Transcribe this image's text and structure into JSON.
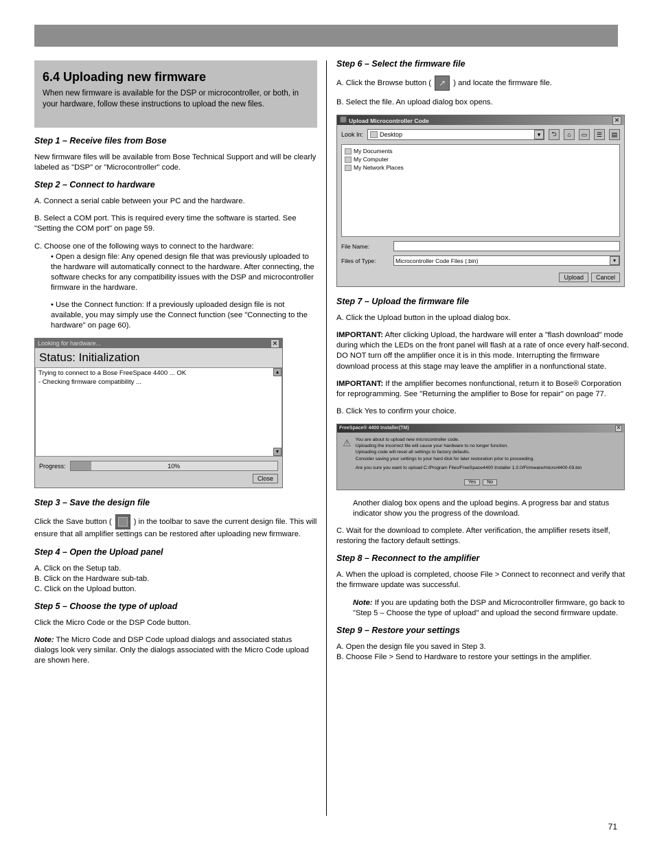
{
  "page_number": "71",
  "intro": {
    "title": "6.4 Uploading new firmware",
    "text": "When new firmware is available for the DSP or microcontroller, or both, in your hardware, follow these instructions to upload the new files."
  },
  "left": {
    "step1_heading": "Step 1 – Receive files from Bose",
    "step1_text": "New firmware files will be available from Bose Technical Support and will be clearly labeled as \"DSP\" or \"Microcontroller\" code.",
    "step2_heading": "Step 2 – Connect to hardware",
    "step2_a": "A. Connect a serial cable between your PC and the hardware.",
    "step2_b": "B. Select a COM port. This is required every time the software is started. See \"Setting the COM port\" on page 59.",
    "step2_c": "C. Choose one of the following ways to connect to the hardware:",
    "step2_c1": "• Open a design file: Any opened design file that was previously uploaded to the hardware will automatically connect to the hardware. After connecting, the software checks for any compatibility issues with the DSP and microcontroller firmware in the hardware.",
    "step2_c2": "• Use the Connect function: If a previously uploaded design file is not available, you may simply use the Connect function (see \"Connecting to the hardware\" on page 60).",
    "hw_dialog": {
      "title": "Looking for hardware...",
      "status_prefix": "Status:",
      "status_value": "Initialization",
      "log_line1": "Trying to connect to a Bose FreeSpace 4400 ... OK",
      "log_line2": "- Checking firmware compatibility ...",
      "progress_label": "Progress:",
      "progress_percent": 10,
      "progress_text": "10%",
      "close": "Close"
    },
    "step3_heading": "Step 3 – Save the design file",
    "step3_text_a": "Click the Save button (",
    "step3_text_b": ") in the toolbar to save the current design file. This will ensure that all amplifier settings can be restored after uploading new firmware.",
    "step4_heading": "Step 4 – Open the Upload panel",
    "step4_a": "A. Click on the Setup tab.",
    "step4_b": "B. Click on the Hardware sub-tab.",
    "step4_c": "C. Click on the Upload button.",
    "step5_heading": "Step 5 – Choose the type of upload",
    "step5_text": "Click the Micro Code or the DSP Code button.",
    "note_label": "Note:",
    "step5_note": "The Micro Code and DSP Code upload dialogs and associated status dialogs look very similar. Only the dialogs associated with the Micro Code upload are shown here."
  },
  "right": {
    "step6_heading": "Step 6 – Select the firmware file",
    "step6_text_a": "A. Click the Browse button (",
    "step6_text_b": ") and locate the firmware file.",
    "step6_b": "B. Select the file. An upload dialog box opens.",
    "upload_dialog": {
      "title": "Upload Microcontroller Code",
      "look_in_label": "Look In:",
      "look_in_value": "Desktop",
      "toolbar_icons": [
        "up-one-level-icon",
        "home-icon",
        "new-folder-icon",
        "list-view-icon",
        "details-view-icon"
      ],
      "file_list": [
        "My Documents",
        "My Computer",
        "My Network Places"
      ],
      "file_name_label": "File Name:",
      "file_name_value": "",
      "files_of_type_label": "Files of Type:",
      "files_of_type_value": "Microcontroller Code Files (.bin)",
      "upload_btn": "Upload",
      "cancel_btn": "Cancel"
    },
    "step7_heading": "Step 7 – Upload the firmware file",
    "step7_a": "A. Click the Upload button in the upload dialog box.",
    "step7_important_label": "IMPORTANT:",
    "step7_important1": "After clicking Upload, the hardware will enter a \"flash download\" mode during which the LEDs on the front panel will flash at a rate of once every half-second. DO NOT turn off the amplifier once it is in this mode. Interrupting the firmware download process at this stage may leave the amplifier in a nonfunctional state.",
    "step7_important2": "If the amplifier becomes nonfunctional, return it to Bose® Corporation for reprogramming. See \"Returning the amplifier to Bose for repair\" on page 77.",
    "step7_b": "B. Click Yes to confirm your choice.",
    "confirm_dialog": {
      "title": "FreeSpace® 4400 Installer(TM)",
      "line1": "You are about to upload new microcontroller code.",
      "line2": "Uploading the incorrect file will cause your hardware to no longer function.",
      "line3": "Uploading code will reset all settings to factory defaults.",
      "line4": "Consider saving your settings to your hard disk for later restoration prior to proceeding.",
      "line5": "Are you sure you want to upload C:/Program Files/FreeSpace4400 Installer 1.0.0/Firmware/micro/4400-03.bin",
      "yes": "Yes",
      "no": "No"
    },
    "after_confirm": "Another dialog box opens and the upload begins. A progress bar and status indicator show you the progress of the download.",
    "step7_c": "C. Wait for the download to complete. After verification, the amplifier resets itself, restoring the factory default settings.",
    "step8_heading": "Step 8 – Reconnect to the amplifier",
    "step8_a": "A. When the upload is completed, choose File > Connect to reconnect and verify that the firmware update was successful.",
    "note_label": "Note:",
    "step8_note": "If you are updating both the DSP and Microcontroller firmware, go back to \"Step 5 – Choose the type of upload\" and upload the second firmware update.",
    "step9_heading": "Step 9 – Restore your settings",
    "step9_a": "A. Open the design file you saved in Step 3.",
    "step9_b": "B. Choose File > Send to Hardware to restore your settings in the amplifier."
  }
}
